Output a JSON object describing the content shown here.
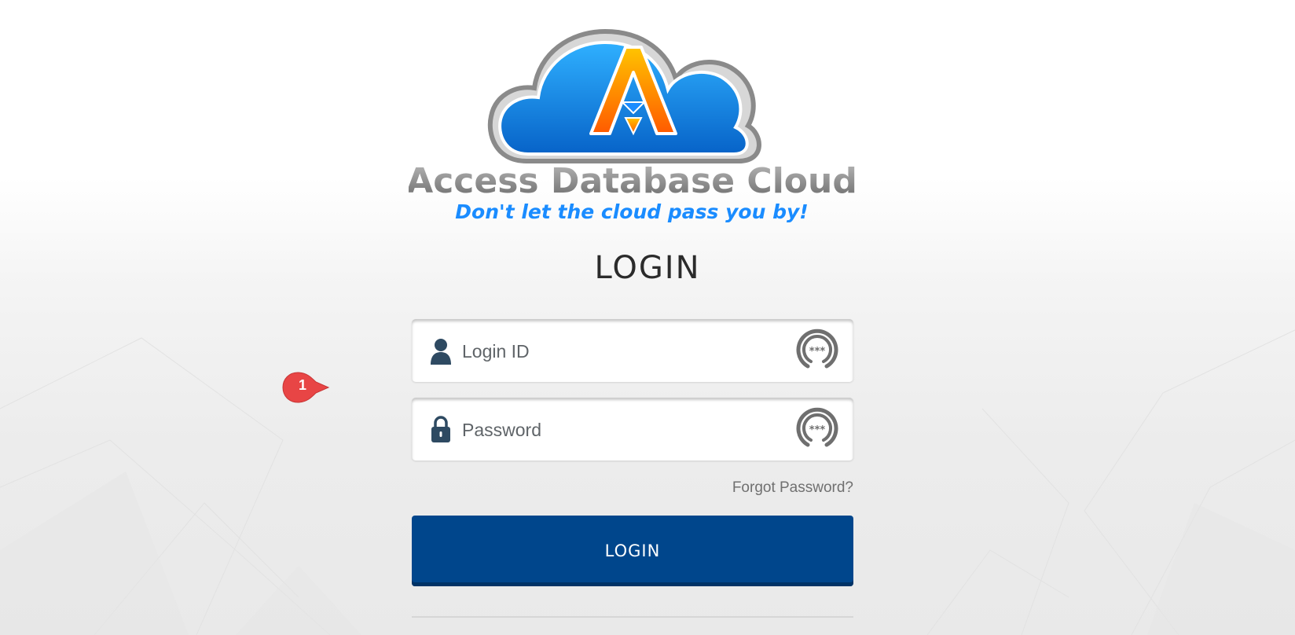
{
  "brand": {
    "name": "Access Database Cloud",
    "tagline": "Don't let the cloud pass you by!",
    "logo_letter": "A"
  },
  "login": {
    "title": "LOGIN",
    "login_id_placeholder": "Login ID",
    "password_placeholder": "Password",
    "forgot_label": "Forgot Password?",
    "submit_label": "LOGIN"
  },
  "annotation": {
    "step": "1"
  },
  "icons": {
    "login_id": "user-icon",
    "password": "lock-icon",
    "password_manager": "password-manager-icon",
    "annotation": "callout-marker-icon"
  },
  "colors": {
    "primary_button": "#00468c",
    "cloud_blue": "#0a78d8",
    "logo_orange": "#ff7a00",
    "tagline_blue": "#1a8cff",
    "callout_red": "#e84545"
  }
}
